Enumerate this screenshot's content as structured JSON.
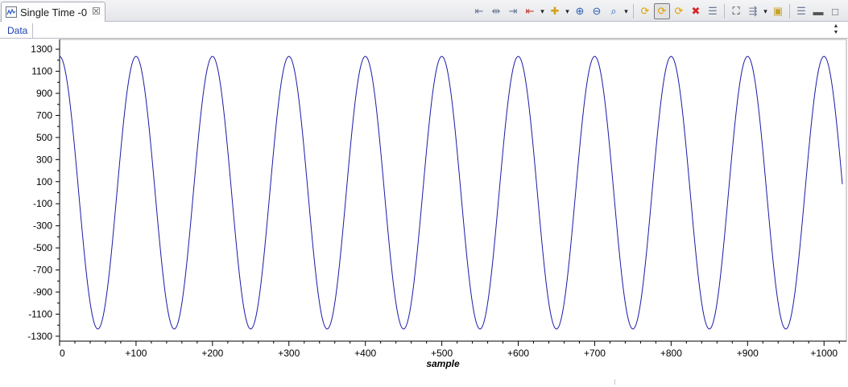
{
  "window": {
    "tab_title": "Single Time -0",
    "tab_icon": "graph-icon",
    "close_glyph": "☒"
  },
  "toolbar": {
    "buttons": [
      {
        "name": "align-left-button",
        "icon": "align-left-icon",
        "glyph": "⇤",
        "color": "#6a7a94"
      },
      {
        "name": "align-center-button",
        "icon": "align-center-icon",
        "glyph": "⇹",
        "color": "#6a7a94"
      },
      {
        "name": "align-right-button",
        "icon": "align-right-icon",
        "glyph": "⇥",
        "color": "#6a7a94"
      },
      {
        "name": "cursor-button",
        "icon": "cursor-icon",
        "glyph": "⇤",
        "color": "#c0392b"
      },
      {
        "name": "cursor-dropdown",
        "icon": "chevron-down-icon",
        "glyph": "▾",
        "dd": true
      },
      {
        "name": "add-measurement-button",
        "icon": "plus-icon",
        "glyph": "✚",
        "color": "#d4a017"
      },
      {
        "name": "add-dropdown",
        "icon": "chevron-down-icon",
        "glyph": "▾",
        "dd": true
      },
      {
        "name": "zoom-in-button",
        "icon": "zoom-in-icon",
        "glyph": "⊕",
        "color": "#2b5fb4"
      },
      {
        "name": "zoom-out-button",
        "icon": "zoom-out-icon",
        "glyph": "⊖",
        "color": "#2b5fb4"
      },
      {
        "name": "zoom-fit-button",
        "icon": "zoom-fit-icon",
        "glyph": "⌕",
        "color": "#2b5fb4"
      },
      {
        "name": "zoom-dropdown",
        "icon": "chevron-down-icon",
        "glyph": "▾",
        "dd": true
      },
      {
        "sep": true
      },
      {
        "name": "refresh-button",
        "icon": "refresh-icon",
        "glyph": "⟳",
        "color": "#e0a000"
      },
      {
        "name": "continuous-refresh-button",
        "icon": "continuous-refresh-icon",
        "glyph": "⟳",
        "color": "#e0a000",
        "active": true
      },
      {
        "name": "auto-refresh-button",
        "icon": "auto-refresh-icon",
        "glyph": "⟳",
        "color": "#e0a000"
      },
      {
        "name": "stop-button",
        "icon": "stop-icon",
        "glyph": "✖",
        "color": "#d6262b"
      },
      {
        "name": "properties-button",
        "icon": "properties-icon",
        "glyph": "☰",
        "color": "#6a7a94"
      },
      {
        "sep": true
      },
      {
        "name": "find-button",
        "icon": "binoculars-icon",
        "glyph": "⛶",
        "color": "#222"
      },
      {
        "name": "import-button",
        "icon": "import-icon",
        "glyph": "⇶",
        "color": "#6a7a94"
      },
      {
        "name": "import-dropdown",
        "icon": "chevron-down-icon",
        "glyph": "▾",
        "dd": true
      },
      {
        "name": "lock-button",
        "icon": "lock-icon",
        "glyph": "▣",
        "color": "#c9a227"
      },
      {
        "sep": true
      },
      {
        "name": "view-menu-button",
        "icon": "view-menu-icon",
        "glyph": "☰",
        "color": "#6a7a94"
      },
      {
        "name": "minimize-button",
        "icon": "minimize-icon",
        "glyph": "▬",
        "color": "#555"
      },
      {
        "name": "maximize-button",
        "icon": "maximize-icon",
        "glyph": "□",
        "color": "#555"
      }
    ]
  },
  "data_tab": {
    "label": "Data"
  },
  "chart_data": {
    "type": "line",
    "title": "",
    "xlabel": "sample",
    "ylabel": "",
    "xlim": [
      0,
      1024
    ],
    "ylim": [
      -1330,
      1330
    ],
    "grid": false,
    "x_ticks": [
      "0",
      "+100",
      "+200",
      "+300",
      "+400",
      "+500",
      "+600",
      "+700",
      "+800",
      "+900",
      "+1000"
    ],
    "x_tick_values": [
      0,
      100,
      200,
      300,
      400,
      500,
      600,
      700,
      800,
      900,
      1000
    ],
    "y_ticks": [
      "1300",
      "1100",
      "900",
      "700",
      "500",
      "300",
      "100",
      "-100",
      "-300",
      "-500",
      "-700",
      "-900",
      "-1100",
      "-1300"
    ],
    "y_tick_values": [
      1300,
      1100,
      900,
      700,
      500,
      300,
      100,
      -100,
      -300,
      -500,
      -700,
      -900,
      -1100,
      -1300
    ],
    "series": [
      {
        "color": "#1a1aa8",
        "generator": {
          "kind": "sine",
          "amplitude": 1235,
          "period_samples": 100,
          "phase_samples": 0,
          "x_from": 0,
          "x_to": 1024
        }
      }
    ]
  }
}
